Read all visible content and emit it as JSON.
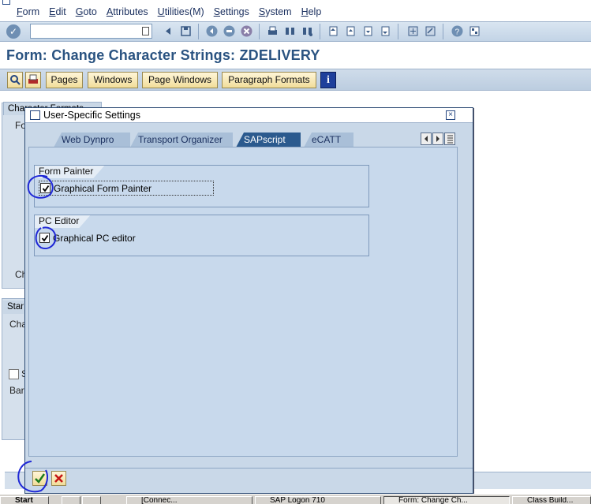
{
  "menubar": {
    "items": [
      "Form",
      "Edit",
      "Goto",
      "Attributes",
      "Utilities(M)",
      "Settings",
      "System",
      "Help"
    ]
  },
  "command_field": {
    "value": ""
  },
  "title": "Form: Change Character Strings: ZDELIVERY",
  "app_toolbar": {
    "buttons": [
      "Pages",
      "Windows",
      "Page Windows",
      "Paragraph Formats"
    ],
    "info_label": "i"
  },
  "background": {
    "tab_char": "Character Formats",
    "frag_fo": "Fo",
    "frag_ch": "Ch",
    "tab_std": "Stan",
    "frag_cha": "Cha",
    "frag_s": "S",
    "frag_bar": "Bar"
  },
  "dialog": {
    "title": "User-Specific Settings",
    "close_glyph": "×",
    "tabs": [
      "Web Dynpro",
      "Transport Organizer",
      "SAPscript",
      "eCATT"
    ],
    "selected_tab": "SAPscript",
    "groups": [
      {
        "title": "Form Painter",
        "checkbox_label": "Graphical Form Painter",
        "checked": true
      },
      {
        "title": "PC Editor",
        "checkbox_label": "Graphical PC editor",
        "checked": true
      }
    ]
  },
  "taskbar": {
    "items": [
      "Start",
      "",
      "",
      "[Connec...",
      "SAP Logon 710",
      "Form: Change Ch...",
      "Class Build..."
    ]
  },
  "colors": {
    "accent": "#2b5a8e",
    "title": "#2a5381",
    "annotation": "#1f28d6"
  }
}
